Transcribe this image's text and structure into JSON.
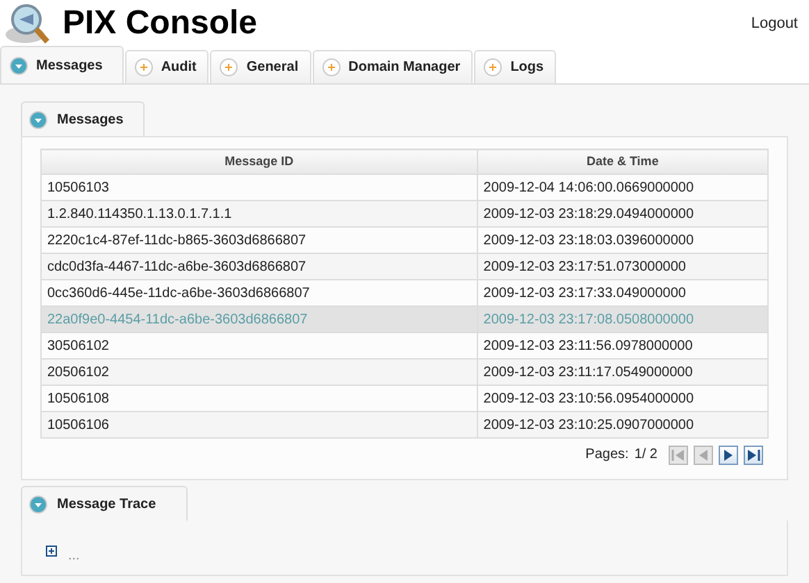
{
  "header": {
    "title": "PIX Console",
    "logout": "Logout"
  },
  "tabs": [
    {
      "label": "Messages",
      "selected": true
    },
    {
      "label": "Audit",
      "selected": false
    },
    {
      "label": "General",
      "selected": false
    },
    {
      "label": "Domain Manager",
      "selected": false
    },
    {
      "label": "Logs",
      "selected": false
    }
  ],
  "messages_panel": {
    "tab": "Messages",
    "columns": [
      "Message ID",
      "Date & Time"
    ],
    "rows": [
      {
        "cells": [
          "10506103",
          "2009-12-04 14:06:00.0669000000"
        ],
        "selected": false
      },
      {
        "cells": [
          "1.2.840.114350.1.13.0.1.7.1.1",
          "2009-12-03 23:18:29.0494000000"
        ],
        "selected": false
      },
      {
        "cells": [
          "2220c1c4-87ef-11dc-b865-3603d6866807",
          "2009-12-03 23:18:03.0396000000"
        ],
        "selected": false
      },
      {
        "cells": [
          "cdc0d3fa-4467-11dc-a6be-3603d6866807",
          "2009-12-03 23:17:51.073000000"
        ],
        "selected": false
      },
      {
        "cells": [
          "0cc360d6-445e-11dc-a6be-3603d6866807",
          "2009-12-03 23:17:33.049000000"
        ],
        "selected": false
      },
      {
        "cells": [
          "22a0f9e0-4454-11dc-a6be-3603d6866807",
          "2009-12-03 23:17:08.0508000000"
        ],
        "selected": true
      },
      {
        "cells": [
          "30506102",
          "2009-12-03 23:11:56.0978000000"
        ],
        "selected": false
      },
      {
        "cells": [
          "20506102",
          "2009-12-03 23:11:17.0549000000"
        ],
        "selected": false
      },
      {
        "cells": [
          "10506108",
          "2009-12-03 23:10:56.0954000000"
        ],
        "selected": false
      },
      {
        "cells": [
          "10506106",
          "2009-12-03 23:10:25.0907000000"
        ],
        "selected": false
      }
    ],
    "pages": "Pages:",
    "page_value": "1/ 2",
    "pager": [
      {
        "kind": "first",
        "disabled": true
      },
      {
        "kind": "prev",
        "disabled": true
      },
      {
        "kind": "next",
        "disabled": false
      },
      {
        "kind": "last",
        "disabled": false
      }
    ]
  },
  "trace_panel": {
    "tab": "Message Trace",
    "node": "...",
    "expanded": false
  }
}
